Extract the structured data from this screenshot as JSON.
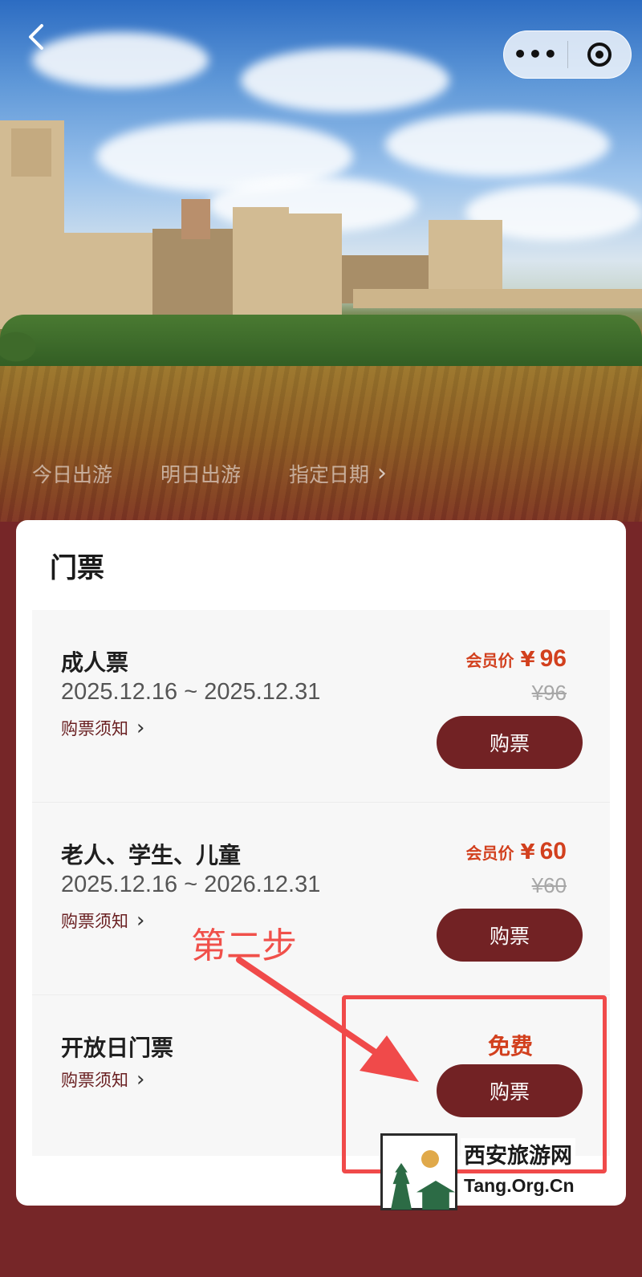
{
  "header": {
    "back_icon": "chevron-left-icon",
    "capsule": {
      "more_label": "•••",
      "more_icon": "more-dots-icon",
      "target_icon": "target-icon"
    }
  },
  "date_tabs": [
    {
      "label": "今日出游"
    },
    {
      "label": "明日出游"
    },
    {
      "label": "指定日期"
    }
  ],
  "date_tab_arrow": "›",
  "card": {
    "title": "门票",
    "tickets": [
      {
        "name": "成人票",
        "dates": "2025.12.16 ~ 2025.12.31",
        "notice": "购票须知",
        "price_label": "会员价",
        "currency": "¥",
        "price": "96",
        "original_price": "¥96",
        "buy_label": "购票"
      },
      {
        "name": "老人、学生、儿童",
        "dates": "2025.12.16 ~ 2026.12.31",
        "notice": "购票须知",
        "price_label": "会员价",
        "currency": "¥",
        "price": "60",
        "original_price": "¥60",
        "buy_label": "购票"
      },
      {
        "name": "开放日门票",
        "notice": "购票须知",
        "price_text": "免费",
        "buy_label": "购票"
      }
    ]
  },
  "annotation": {
    "step_label": "第二步",
    "color": "#f04a4a"
  },
  "watermark": {
    "name_cn": "西安旅游网",
    "name_en": "Tang.Org.Cn"
  },
  "colors": {
    "brand": "#722224",
    "price": "#d2401e",
    "background": "#762628"
  }
}
